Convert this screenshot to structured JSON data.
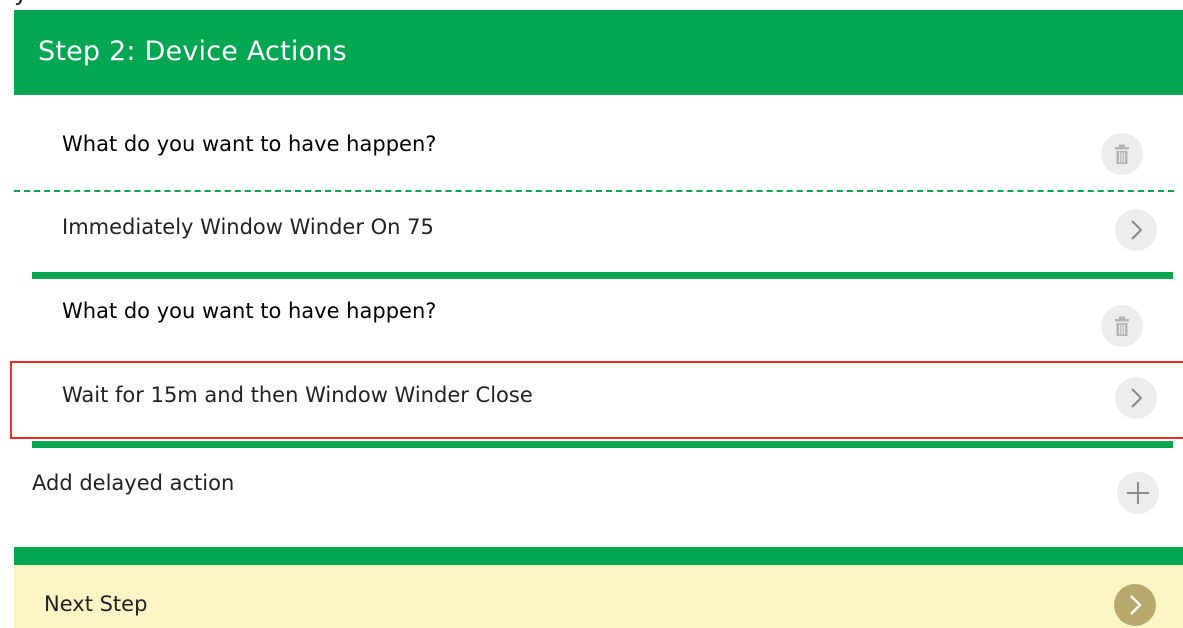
{
  "header": {
    "title": "Step 2: Device Actions"
  },
  "actions": [
    {
      "question": "What do you want to have happen?",
      "answer": "Immediately Window Winder On 75"
    },
    {
      "question": "What do you want to have happen?",
      "answer": "Wait for 15m and then Window Winder Close"
    }
  ],
  "add_delayed": {
    "label": "Add delayed action"
  },
  "next_step": {
    "label": "Next Step"
  },
  "icons": {
    "delete": "trash-icon",
    "open": "chevron-right-icon",
    "add": "plus-icon",
    "next": "chevron-right-icon"
  },
  "colors": {
    "accent_green": "#00a651",
    "next_step_bg": "#fbf5c6",
    "next_button": "#b7a96c",
    "icon_circle": "#ececec",
    "selection_border": "#e52d2d"
  }
}
